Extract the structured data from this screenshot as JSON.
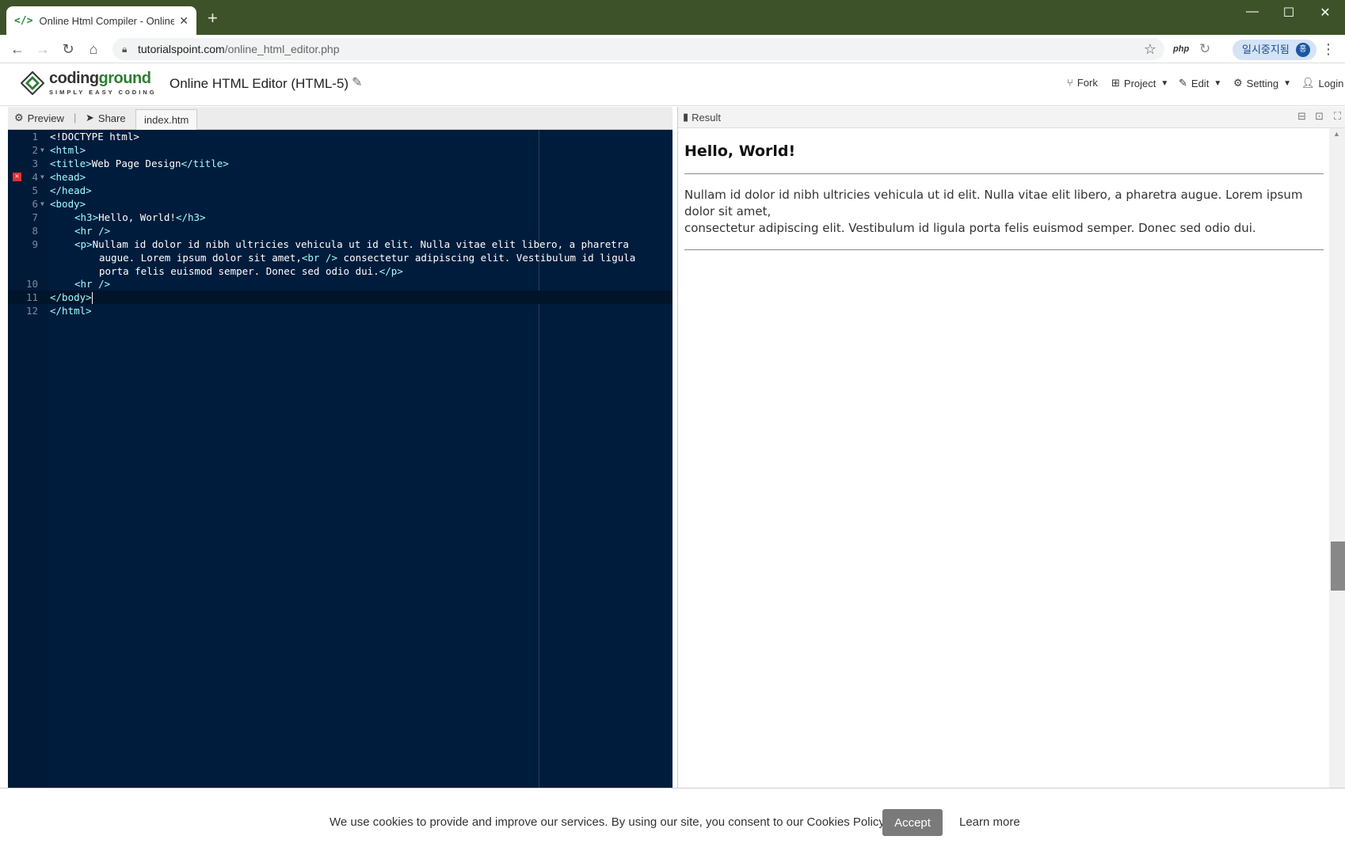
{
  "browser": {
    "tab_title": "Online Html Compiler - Online H",
    "tab_icon": "</>",
    "url_host": "tutorialspoint.com",
    "url_path": "/online_html_editor.php",
    "ext_php": "php",
    "profile_label": "일시중지됨",
    "profile_initial": "홍"
  },
  "site": {
    "logo_word_1": "coding",
    "logo_word_2": "ground",
    "logo_tagline": "SIMPLY EASY CODING",
    "page_title": "Online HTML Editor (HTML-5)",
    "menu": {
      "fork": "Fork",
      "project": "Project",
      "edit": "Edit",
      "setting": "Setting",
      "login": "Login"
    }
  },
  "editor": {
    "toolbar": {
      "preview": "Preview",
      "share": "Share",
      "file_tab": "index.htm"
    },
    "line_numbers": [
      "1",
      "2",
      "3",
      "4",
      "5",
      "6",
      "7",
      "8",
      "9",
      "10",
      "11",
      "12"
    ],
    "code": {
      "l1": "<!DOCTYPE html>",
      "l2": "<html>",
      "l3a": "<title>",
      "l3b": "Web Page Design",
      "l3c": "</title>",
      "l4": "<head>",
      "l5": "</head>",
      "l6": "<body>",
      "l7a": "<h3>",
      "l7b": "Hello, World!",
      "l7c": "</h3>",
      "l8": "<hr />",
      "l9a": "<p>",
      "l9b": "Nullam id dolor id nibh ultricies vehicula ut id elit. Nulla vitae elit libero, a pharetra",
      "l9c": "augue. Lorem ipsum dolor sit amet,",
      "l9d": "<br />",
      "l9e": " consectetur adipiscing elit. Vestibulum id ligula",
      "l9f": "porta felis euismod semper. Donec sed odio dui.",
      "l9g": "</p>",
      "l10": "<hr />",
      "l11": "</body>",
      "l12": "</html>"
    }
  },
  "result": {
    "label": "Result",
    "heading": "Hello, World!",
    "para_line1": "Nullam id dolor id nibh ultricies vehicula ut id elit. Nulla vitae elit libero, a pharetra augue. Lorem ipsum dolor sit amet,",
    "para_line2": "consectetur adipiscing elit. Vestibulum id ligula porta felis euismod semper. Donec sed odio dui."
  },
  "cookie": {
    "message": "We use cookies to provide and improve our services. By using our site, you consent to our Cookies Policy.",
    "accept": "Accept",
    "learn_more": "Learn more"
  }
}
